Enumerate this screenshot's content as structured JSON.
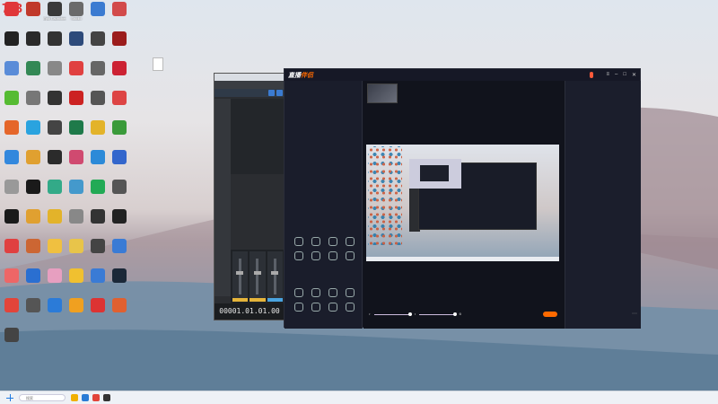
{
  "watermark": "773",
  "desktop": {
    "icons": [
      {
        "label": "",
        "color": "#e0373a"
      },
      {
        "label": "",
        "color": "#c0392b"
      },
      {
        "label": "Epic Launcher",
        "color": "#3a3a3a"
      },
      {
        "label": "Studio",
        "color": "#6a6a6a"
      },
      {
        "label": "",
        "color": "#3b7bd1"
      },
      {
        "label": "",
        "color": "#d24a4a"
      },
      {
        "label": "",
        "color": "#222"
      },
      {
        "label": "",
        "color": "#2a2a2a"
      },
      {
        "label": "",
        "color": "#333"
      },
      {
        "label": "",
        "color": "#2d4a7a"
      },
      {
        "label": "",
        "color": "#444"
      },
      {
        "label": "",
        "color": "#9b1c1c"
      },
      {
        "label": "",
        "color": "#5a8cd8"
      },
      {
        "label": "",
        "color": "#385"
      },
      {
        "label": "",
        "color": "#888"
      },
      {
        "label": "",
        "color": "#e04040"
      },
      {
        "label": "",
        "color": "#666"
      },
      {
        "label": "",
        "color": "#c23"
      },
      {
        "label": "",
        "color": "#5b3"
      },
      {
        "label": "",
        "color": "#777"
      },
      {
        "label": "",
        "color": "#333"
      },
      {
        "label": "",
        "color": "#c22"
      },
      {
        "label": "",
        "color": "#555"
      },
      {
        "label": "",
        "color": "#d44"
      },
      {
        "label": "",
        "color": "#e5662a"
      },
      {
        "label": "",
        "color": "#2aa3df"
      },
      {
        "label": "",
        "color": "#444"
      },
      {
        "label": "",
        "color": "#1f7a4a"
      },
      {
        "label": "",
        "color": "#e3b32a"
      },
      {
        "label": "",
        "color": "#3a9a3a"
      },
      {
        "label": "",
        "color": "#38d"
      },
      {
        "label": "",
        "color": "#e0a030"
      },
      {
        "label": "",
        "color": "#2b2b2b"
      },
      {
        "label": "",
        "color": "#d04a70"
      },
      {
        "label": "",
        "color": "#2c8ad8"
      },
      {
        "label": "",
        "color": "#3366cc"
      },
      {
        "label": "",
        "color": "#999"
      },
      {
        "label": "",
        "color": "#1a1a1a"
      },
      {
        "label": "",
        "color": "#3a8"
      },
      {
        "label": "",
        "color": "#49c"
      },
      {
        "label": "",
        "color": "#2a5"
      },
      {
        "label": "",
        "color": "#555"
      },
      {
        "label": "",
        "color": "#1a1a1a"
      },
      {
        "label": "",
        "color": "#e0a030"
      },
      {
        "label": "",
        "color": "#e3b32a"
      },
      {
        "label": "",
        "color": "#888"
      },
      {
        "label": "",
        "color": "#333"
      },
      {
        "label": "",
        "color": "#222"
      },
      {
        "label": "",
        "color": "#e04040"
      },
      {
        "label": "",
        "color": "#c63"
      },
      {
        "label": "",
        "color": "#f0c040"
      },
      {
        "label": "",
        "color": "#e8c44a"
      },
      {
        "label": "",
        "color": "#444"
      },
      {
        "label": "",
        "color": "#3a7bd5"
      },
      {
        "label": "",
        "color": "#e66"
      },
      {
        "label": "",
        "color": "#2a6fd1"
      },
      {
        "label": "",
        "color": "#e79fc0"
      },
      {
        "label": "",
        "color": "#f0c030"
      },
      {
        "label": "",
        "color": "#3a7bd5"
      },
      {
        "label": "",
        "color": "#1b2838"
      },
      {
        "label": "",
        "color": "#e2443a"
      },
      {
        "label": "",
        "color": "#555"
      },
      {
        "label": "",
        "color": "#2b7bd8"
      },
      {
        "label": "",
        "color": "#f0a020"
      },
      {
        "label": "",
        "color": "#d33"
      },
      {
        "label": "",
        "color": "#e06030"
      },
      {
        "label": "",
        "color": "#444"
      }
    ],
    "file": {
      "label": ""
    }
  },
  "daw": {
    "title": "",
    "menu": [],
    "tracks": [],
    "timecode": "00001.01.01.00"
  },
  "app": {
    "logo_main": "直播",
    "logo_accent": "伴侣",
    "badge": "",
    "scenes": {
      "tabs": [],
      "items": [],
      "add_label": "",
      "interact_title": "",
      "tools1": [
        "",
        "",
        "",
        "",
        "",
        "",
        "",
        ""
      ],
      "tools_title": "",
      "tools2": [
        "",
        "",
        "",
        "",
        "",
        "",
        "",
        ""
      ],
      "more": ""
    },
    "stream": {
      "title": "",
      "status_tag": "",
      "meta_tags": [],
      "links": [],
      "go_live": "",
      "footer": ""
    },
    "side": {
      "title": "",
      "action": "",
      "section": "",
      "lines": [],
      "chat": [],
      "send": ""
    }
  },
  "taskbar": {
    "search_placeholder": "搜索",
    "time": "",
    "date": ""
  }
}
